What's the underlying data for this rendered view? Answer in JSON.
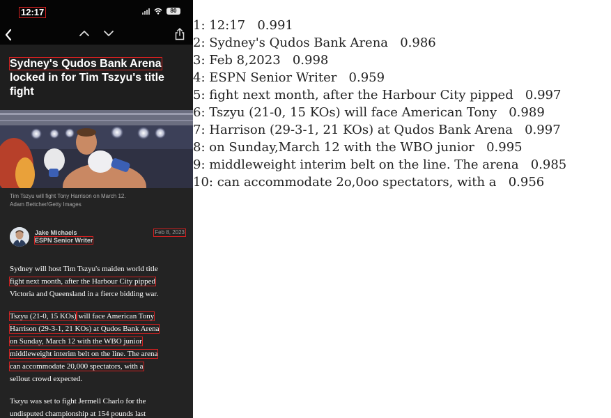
{
  "status_bar": {
    "time": "12:17",
    "battery": "80"
  },
  "article": {
    "headline": "Sydney's Qudos Bank Arena locked in for Tim Tszyu's title fight",
    "headline_line1": "Sydney's Qudos Bank Arena",
    "headline_line2": "locked in for Tim Tszyu's title",
    "headline_line3": "fight",
    "caption_line1": "Tim Tszyu will fight Tony Harrison on March 12.",
    "caption_line2": "Adam Bettcher/Getty Images",
    "author_name": "Jake Michaels",
    "author_role": "ESPN Senior Writer",
    "date": "Feb 8, 2023",
    "p1": [
      "Sydney will host Tim Tszyu's maiden world title",
      "fight next month, after the Harbour City pipped",
      "Victoria and Queensland in a fierce bidding war."
    ],
    "p2": [
      "Tszyu (21-0, 15 KOs)",
      " will face American Tony",
      "Harrison (29-3-1, 21 KOs) at Qudos Bank Arena",
      "on Sunday, March 12 with the WBO junior",
      "middleweight interim belt on the line. The arena",
      "can accommodate 20,000 spectators, with a",
      "sellout crowd expected."
    ],
    "p3": [
      "Tszyu was set to fight Jermell Charlo for the",
      "undisputed championship at 154 pounds last"
    ]
  },
  "ocr_results": [
    {
      "index": "1:",
      "text": "12:17",
      "score": "0.991"
    },
    {
      "index": "2:",
      "text": "Sydney's Qudos Bank Arena",
      "score": "0.986"
    },
    {
      "index": "3:",
      "text": "Feb 8,2023",
      "score": "0.998"
    },
    {
      "index": "4:",
      "text": "ESPN Senior Writer",
      "score": "0.959"
    },
    {
      "index": "5:",
      "text": "fight next month, after the Harbour City pipped",
      "score": "0.997"
    },
    {
      "index": "6:",
      "text": "Tszyu (21-0, 15 KOs) will face American Tony",
      "score": "0.989"
    },
    {
      "index": "7:",
      "text": "Harrison (29-3-1, 21 KOs) at Qudos Bank Arena",
      "score": "0.997"
    },
    {
      "index": "8:",
      "text": "on Sunday,March 12 with the WBO junior",
      "score": "0.995"
    },
    {
      "index": "9:",
      "text": "middleweight interim belt on the line. The arena",
      "score": "0.985"
    },
    {
      "index": "10:",
      "text": "can accommodate 2o,0oo spectators, with a",
      "score": "0.956"
    }
  ],
  "colors": {
    "highlight_box": "#d02020",
    "phone_bg": "#232323",
    "text_panel_bg": "#ffffff"
  }
}
